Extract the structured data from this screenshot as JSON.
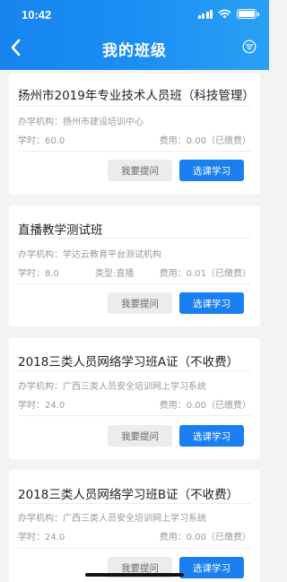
{
  "status_bar": {
    "time": "10:42"
  },
  "header": {
    "title": "我的班级"
  },
  "labels": {
    "org_prefix": "办学机构：",
    "hours_prefix": "学时：",
    "type_prefix": "类型:",
    "fee_prefix": "费用：",
    "ask_button": "我要提问",
    "study_button": "选课学习"
  },
  "classes": [
    {
      "title": "扬州市2019年专业技术人员班（科技管理）",
      "org": "扬州市建设培训中心",
      "hours": "60.0",
      "type": "",
      "fee": "0.00（已缴费）"
    },
    {
      "title": "直播教学测试班",
      "org": "学达云教育平台测试机构",
      "hours": "8.0",
      "type": "直播",
      "fee": "0.01（已缴费）"
    },
    {
      "title": "2018三类人员网络学习班A证（不收费）",
      "org": "广西三类人员安全培训网上学习系统",
      "hours": "24.0",
      "type": "",
      "fee": "0.00（已缴费）"
    },
    {
      "title": "2018三类人员网络学习班B证（不收费）",
      "org": "广西三类人员安全培训网上学习系统",
      "hours": "24.0",
      "type": "",
      "fee": "0.00（已缴费）"
    }
  ]
}
